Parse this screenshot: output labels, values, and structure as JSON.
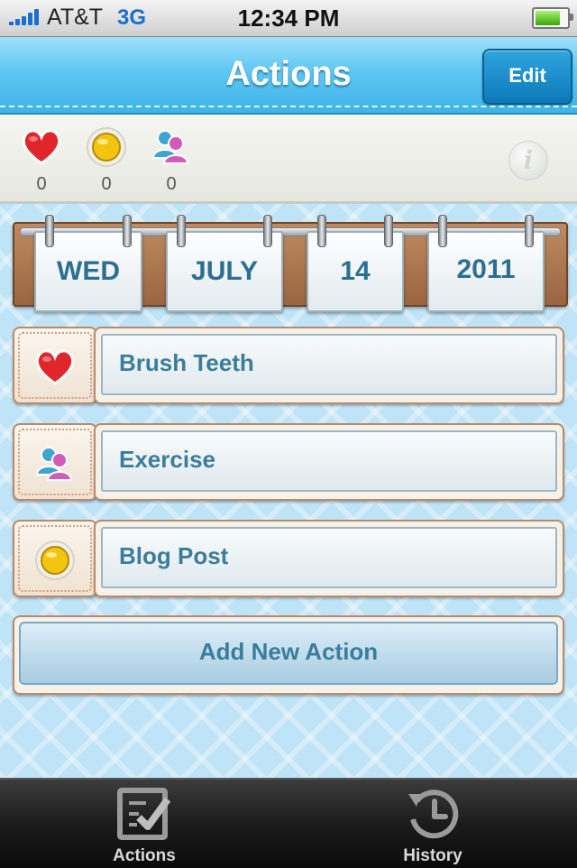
{
  "status_bar": {
    "carrier": "AT&T",
    "network": "3G",
    "time": "12:34 PM",
    "battery_level": 0.9
  },
  "nav": {
    "title": "Actions",
    "edit_label": "Edit"
  },
  "counters": [
    {
      "icon": "heart-icon",
      "value": "0"
    },
    {
      "icon": "coin-icon",
      "value": "0"
    },
    {
      "icon": "users-icon",
      "value": "0"
    }
  ],
  "info_icon": "i",
  "date": {
    "weekday": "WED",
    "month": "JULY",
    "day": "14",
    "year": "2011"
  },
  "actions": [
    {
      "icon": "heart-icon",
      "label": "Brush Teeth"
    },
    {
      "icon": "users-icon",
      "label": "Exercise"
    },
    {
      "icon": "coin-icon",
      "label": "Blog Post"
    }
  ],
  "add_action_label": "Add New Action",
  "tabs": [
    {
      "icon": "checklist-icon",
      "label": "Actions"
    },
    {
      "icon": "history-icon",
      "label": "History"
    }
  ],
  "colors": {
    "accent": "#3fb3e8",
    "text_blue": "#3b7d9b",
    "wood": "#b98a6b"
  }
}
